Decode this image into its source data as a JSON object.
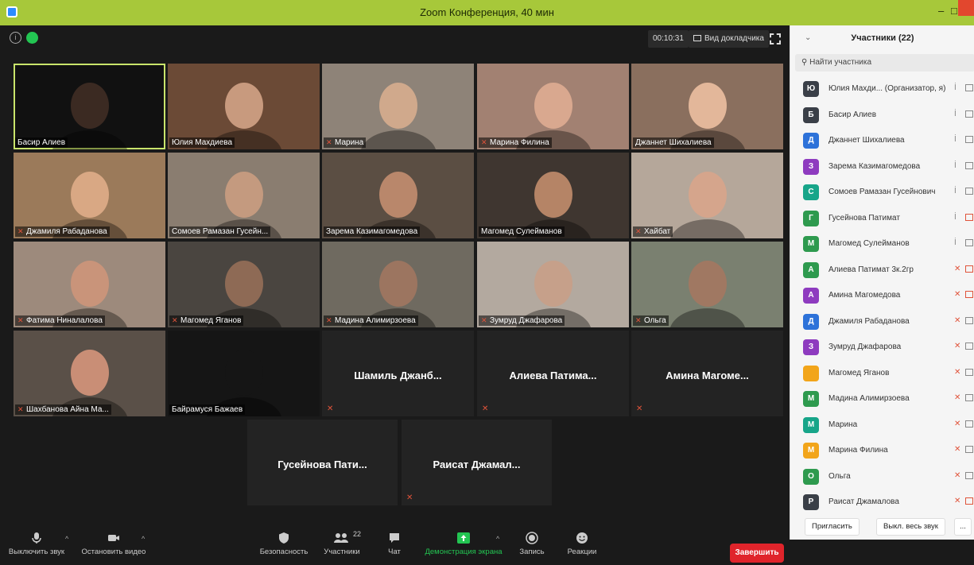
{
  "window": {
    "title": "Zoom Конференция, 40 мин"
  },
  "topbar": {
    "timer": "00:10:31",
    "speaker_view_label": "Вид докладчика"
  },
  "tiles": [
    {
      "name": "Басир Алиев",
      "muted": false,
      "video": true,
      "active": true,
      "bg": "#111111",
      "face": "#3b2a22"
    },
    {
      "name": "Юлия Махдиева",
      "muted": false,
      "video": true,
      "bg": "#6b4a36",
      "face": "#c89a7e"
    },
    {
      "name": "Марина",
      "muted": true,
      "video": true,
      "bg": "#8e8378",
      "face": "#d0a98c"
    },
    {
      "name": "Марина Филина",
      "muted": true,
      "video": true,
      "bg": "#a28172",
      "face": "#d9a88f"
    },
    {
      "name": "Джаннет Шихалиева",
      "muted": false,
      "video": true,
      "bg": "#8a6f5e",
      "face": "#e3b79a"
    },
    {
      "name": "Джамиля Рабаданова",
      "muted": true,
      "video": true,
      "bg": "#9b7a5a",
      "face": "#d9a884"
    },
    {
      "name": "Сомоев Рамазан Гусейн...",
      "muted": false,
      "video": true,
      "bg": "#8a7d70",
      "face": "#c49a7f"
    },
    {
      "name": "Зарема Казимагомедова",
      "muted": false,
      "video": true,
      "bg": "#5b4e43",
      "face": "#b9876b"
    },
    {
      "name": "Магомед Сулейманов",
      "muted": false,
      "video": true,
      "bg": "#3f3630",
      "face": "#b58466"
    },
    {
      "name": "Хайбат",
      "muted": true,
      "video": true,
      "bg": "#b5a79a",
      "face": "#d5a58c"
    },
    {
      "name": "Фатима Ниналалова",
      "muted": true,
      "video": true,
      "bg": "#9d8a7c",
      "face": "#c9947a"
    },
    {
      "name": "Магомед Яганов",
      "muted": true,
      "video": true,
      "bg": "#4a4540",
      "face": "#8e6a55"
    },
    {
      "name": "Мадина Алимирзоева",
      "muted": true,
      "video": true,
      "bg": "#6f6a60",
      "face": "#9c7560"
    },
    {
      "name": "Зумруд Джафарова",
      "muted": true,
      "video": true,
      "bg": "#b3a99f",
      "face": "#c6a08a"
    },
    {
      "name": "Ольга",
      "muted": true,
      "video": true,
      "bg": "#7a8070",
      "face": "#a07862"
    },
    {
      "name": "Шахбанова Айна Ма...",
      "muted": true,
      "video": true,
      "bg": "#5a5048",
      "face": "#c98e76"
    },
    {
      "name": "Байрамуся Бажаев",
      "muted": false,
      "video": true,
      "bg": "#151515",
      "face": "#151515"
    },
    {
      "name": "Шамиль Джанб...",
      "muted": true,
      "video": false
    },
    {
      "name": "Алиева Патима...",
      "muted": true,
      "video": false
    },
    {
      "name": "Амина Магоме...",
      "muted": true,
      "video": false
    },
    {
      "name": "Гусейнова Пати...",
      "muted": false,
      "video": false
    },
    {
      "name": "Раисат Джамал...",
      "muted": true,
      "video": false
    }
  ],
  "toolbar": {
    "mute_label": "Выключить звук",
    "video_label": "Остановить видео",
    "security_label": "Безопасность",
    "participants_label": "Участники",
    "participants_count": "22",
    "chat_label": "Чат",
    "share_label": "Демонстрация экрана",
    "record_label": "Запись",
    "reactions_label": "Реакции",
    "end_label": "Завершить"
  },
  "panel": {
    "title": "Участники (22)",
    "search_placeholder": "Найти участника",
    "invite_label": "Пригласить",
    "mute_all_label": "Выкл. весь звук",
    "more_label": "...",
    "participants": [
      {
        "initial": "Ю",
        "name": "Юлия Махди...  (Организатор, я)",
        "color": "#3a3f47",
        "mic_off": false,
        "cam_off": false
      },
      {
        "initial": "Б",
        "name": "Басир Алиев",
        "color": "#3a3f47",
        "mic_off": false,
        "cam_off": false
      },
      {
        "initial": "Д",
        "name": "Джаннет Шихалиева",
        "color": "#2d72d9",
        "mic_off": false,
        "cam_off": false
      },
      {
        "initial": "З",
        "name": "Зарема Казимагомедова",
        "color": "#8e3bbf",
        "mic_off": false,
        "cam_off": false
      },
      {
        "initial": "С",
        "name": "Сомоев Рамазан Гусейнович",
        "color": "#17a589",
        "mic_off": false,
        "cam_off": false
      },
      {
        "initial": "Г",
        "name": "Гусейнова Патимат",
        "color": "#2e9a4e",
        "mic_off": false,
        "cam_off": true
      },
      {
        "initial": "М",
        "name": "Магомед Сулейманов",
        "color": "#2e9a4e",
        "mic_off": false,
        "cam_off": false
      },
      {
        "initial": "А",
        "name": "Алиева Патимат 3к.2гр",
        "color": "#2e9a4e",
        "mic_off": true,
        "cam_off": true
      },
      {
        "initial": "А",
        "name": "Амина Магомедова",
        "color": "#8e3bbf",
        "mic_off": true,
        "cam_off": true
      },
      {
        "initial": "Д",
        "name": "Джамиля Рабаданова",
        "color": "#2d72d9",
        "mic_off": true,
        "cam_off": false
      },
      {
        "initial": "З",
        "name": "Зумруд Джафарова",
        "color": "#8e3bbf",
        "mic_off": true,
        "cam_off": false
      },
      {
        "initial": "",
        "name": "Магомед Яганов",
        "color": "#f2a51a",
        "mic_off": true,
        "cam_off": false
      },
      {
        "initial": "М",
        "name": "Мадина Алимирзоева",
        "color": "#2e9a4e",
        "mic_off": true,
        "cam_off": false
      },
      {
        "initial": "М",
        "name": "Марина",
        "color": "#17a589",
        "mic_off": true,
        "cam_off": false
      },
      {
        "initial": "М",
        "name": "Марина Филина",
        "color": "#f2a51a",
        "mic_off": true,
        "cam_off": false
      },
      {
        "initial": "О",
        "name": "Ольга",
        "color": "#2e9a4e",
        "mic_off": true,
        "cam_off": false
      },
      {
        "initial": "Р",
        "name": "Раисат Джамалова",
        "color": "#3a3f47",
        "mic_off": true,
        "cam_off": true
      }
    ]
  }
}
